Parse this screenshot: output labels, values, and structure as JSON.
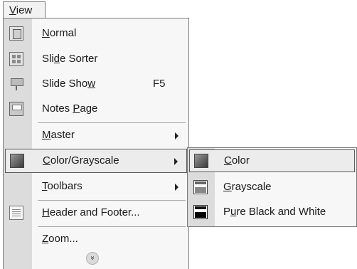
{
  "menubar": {
    "pre": "",
    "accel": "V",
    "post": "iew"
  },
  "view_menu": {
    "items": [
      {
        "id": "normal",
        "icon": "normal-view-icon",
        "pre": "",
        "accel": "N",
        "post": "ormal"
      },
      {
        "id": "slide-sorter",
        "icon": "slide-sorter-icon",
        "pre": "Sli",
        "accel": "d",
        "post": "e Sorter"
      },
      {
        "id": "slide-show",
        "icon": "slide-show-icon",
        "pre": "Slide Sho",
        "accel": "w",
        "post": "",
        "shortcut": "F5"
      },
      {
        "id": "notes-page",
        "icon": "notes-page-icon",
        "pre": "Notes ",
        "accel": "P",
        "post": "age"
      },
      {
        "id": "master",
        "pre": "",
        "accel": "M",
        "post": "aster",
        "submenu": true
      },
      {
        "id": "color-grayscale",
        "icon": "color-grayscale-icon",
        "pre": "",
        "accel": "C",
        "post": "olor/Grayscale",
        "submenu": true,
        "highlighted": true
      },
      {
        "id": "toolbars",
        "pre": "",
        "accel": "T",
        "post": "oolbars",
        "submenu": true
      },
      {
        "id": "header-footer",
        "icon": "header-footer-icon",
        "pre": "",
        "accel": "H",
        "post": "eader and Footer..."
      },
      {
        "id": "zoom",
        "pre": "",
        "accel": "Z",
        "post": "oom..."
      }
    ],
    "expand_glyph": "»"
  },
  "color_submenu": {
    "items": [
      {
        "id": "color",
        "icon": "color-icon",
        "pre": "",
        "accel": "C",
        "post": "olor",
        "highlighted": true
      },
      {
        "id": "grayscale",
        "icon": "grayscale-icon",
        "pre": "",
        "accel": "G",
        "post": "rayscale"
      },
      {
        "id": "pure-bw",
        "icon": "pure-black-white-icon",
        "pre": "P",
        "accel": "u",
        "post": "re Black and White"
      }
    ]
  }
}
